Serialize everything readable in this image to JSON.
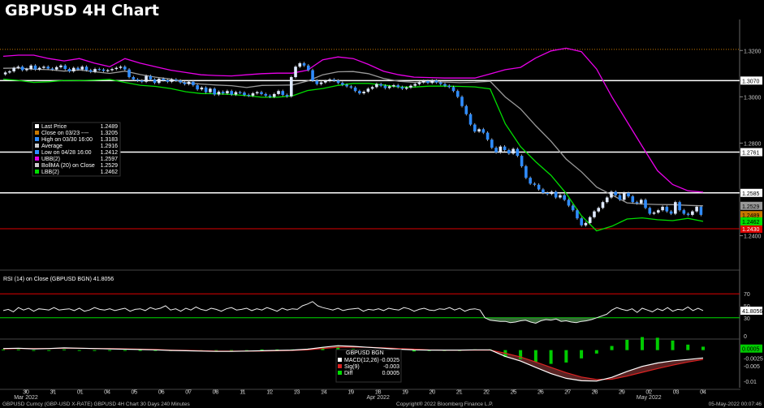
{
  "title": "GBPUSD 4H Chart",
  "colors": {
    "candle": "#2f8cff",
    "ubb": "#e800e8",
    "lbb": "#00dd00",
    "mid": "#999999",
    "close_line": "#c87800",
    "support": "#ffffff",
    "red": "#dd0000"
  },
  "chart_data": {
    "type": "candlestick",
    "x_ticks": [
      "30",
      "31",
      "01",
      "04",
      "05",
      "06",
      "07",
      "08",
      "11",
      "12",
      "13",
      "14",
      "19",
      "18",
      "19",
      "20",
      "21",
      "22",
      "25",
      "26",
      "27",
      "28",
      "29",
      "02",
      "03",
      "04"
    ],
    "month_labels": [
      "Mar 2022",
      "Apr 2022",
      "May 2022"
    ],
    "y_ticks": [
      "1.3200",
      "1.3000",
      "1.2800",
      "1.2400"
    ],
    "y_range": [
      1.236,
      1.332
    ],
    "levels": [
      {
        "name": "close-0323",
        "value": 1.3205,
        "label": "",
        "style": "dotted"
      },
      {
        "name": "resistance-1",
        "value": 1.307,
        "label": "1.3070",
        "style": "white"
      },
      {
        "name": "resistance-2",
        "value": 1.2761,
        "label": "1.2761",
        "style": "white"
      },
      {
        "name": "resistance-3",
        "value": 1.2585,
        "label": "1.2585",
        "style": "white"
      },
      {
        "name": "support-1",
        "value": 1.243,
        "label": "1.2430",
        "style": "red"
      }
    ],
    "price_tags": [
      {
        "value": 1.2529,
        "label": "1.2529",
        "color": "#999999"
      },
      {
        "value": 1.2489,
        "label": "1.2489",
        "color": "#c87800"
      },
      {
        "value": 1.2462,
        "label": "1.2462",
        "color": "#00dd00"
      }
    ],
    "closes": [
      1.3105,
      1.311,
      1.3125,
      1.313,
      1.3115,
      1.312,
      1.3135,
      1.3118,
      1.3125,
      1.313,
      1.3122,
      1.3118,
      1.3128,
      1.3135,
      1.312,
      1.311,
      1.3125,
      1.3118,
      1.313,
      1.3115,
      1.3108,
      1.312,
      1.3118,
      1.3112,
      1.3115,
      1.312,
      1.3125,
      1.313,
      1.3118,
      1.3085,
      1.3075,
      1.307,
      1.3065,
      1.309,
      1.3075,
      1.306,
      1.3078,
      1.3072,
      1.3065,
      1.3075,
      1.307,
      1.3062,
      1.3055,
      1.3065,
      1.305,
      1.3032,
      1.304,
      1.302,
      1.3035,
      1.301,
      1.3022,
      1.3015,
      1.3025,
      1.301,
      1.302,
      1.3018,
      1.3008,
      1.3005,
      1.3015,
      1.302,
      1.3012,
      1.3005,
      1.3,
      1.3012,
      1.3025,
      1.3008,
      1.3002,
      1.3085,
      1.313,
      1.3145,
      1.3135,
      1.3115,
      1.307,
      1.3055,
      1.3062,
      1.3068,
      1.3075,
      1.307,
      1.306,
      1.3052,
      1.3045,
      1.304,
      1.3025,
      1.3015,
      1.3022,
      1.3035,
      1.3042,
      1.3055,
      1.3048,
      1.3038,
      1.3045,
      1.305,
      1.3042,
      1.3035,
      1.304,
      1.3048,
      1.3055,
      1.3062,
      1.3068,
      1.306,
      1.307,
      1.3062,
      1.3055,
      1.3048,
      1.3042,
      1.3025,
      1.3,
      1.296,
      1.2925,
      1.288,
      1.285,
      1.286,
      1.2845,
      1.2815,
      1.278,
      1.276,
      1.2785,
      1.277,
      1.2755,
      1.2775,
      1.2745,
      1.27,
      1.265,
      1.2625,
      1.262,
      1.26,
      1.2585,
      1.258,
      1.259,
      1.2565,
      1.2575,
      1.2555,
      1.253,
      1.251,
      1.2475,
      1.2445,
      1.2455,
      1.248,
      1.2505,
      1.252,
      1.2545,
      1.2565,
      1.259,
      1.2575,
      1.2555,
      1.2585,
      1.257,
      1.2545,
      1.254,
      1.2555,
      1.252,
      1.2495,
      1.25,
      1.251,
      1.2525,
      1.2505,
      1.2495,
      1.2545,
      1.251,
      1.2495,
      1.249,
      1.2505,
      1.2525,
      1.249
    ],
    "ubb": [
      1.3175,
      1.318,
      1.318,
      1.3165,
      1.3155,
      1.3165,
      1.3145,
      1.313,
      1.3165,
      1.3145,
      1.313,
      1.3115,
      1.3105,
      1.3095,
      1.3092,
      1.309,
      1.3095,
      1.31,
      1.3102,
      1.3102,
      1.3115,
      1.316,
      1.3172,
      1.3165,
      1.314,
      1.311,
      1.3095,
      1.3085,
      1.3083,
      1.3081,
      1.3081,
      1.3081,
      1.3099,
      1.3117,
      1.3127,
      1.3168,
      1.3198,
      1.321,
      1.3195,
      1.312,
      1.3,
      1.2893,
      1.2786,
      1.2681,
      1.2621,
      1.2594,
      1.2588
    ],
    "lbb": [
      1.3076,
      1.3071,
      1.3062,
      1.3065,
      1.3071,
      1.307,
      1.3072,
      1.3075,
      1.3062,
      1.305,
      1.3045,
      1.3036,
      1.3022,
      1.3014,
      1.3013,
      1.301,
      1.3005,
      1.2998,
      1.2998,
      1.3004,
      1.3027,
      1.3036,
      1.3049,
      1.3058,
      1.3058,
      1.3051,
      1.3043,
      1.3042,
      1.3046,
      1.3046,
      1.3045,
      1.3043,
      1.3034,
      1.2883,
      1.2785,
      1.2719,
      1.2661,
      1.2583,
      1.2486,
      1.2421,
      1.2441,
      1.2472,
      1.2477,
      1.2469,
      1.2465,
      1.2475,
      1.2462
    ],
    "mid": [
      1.3123,
      1.3124,
      1.3119,
      1.3117,
      1.3111,
      1.3116,
      1.3108,
      1.3101,
      1.3111,
      1.3096,
      1.3085,
      1.3077,
      1.306,
      1.3055,
      1.3051,
      1.3048,
      1.304,
      1.3049,
      1.305,
      1.3051,
      1.3068,
      1.3095,
      1.3108,
      1.3109,
      1.31,
      1.3079,
      1.3067,
      1.3062,
      1.3065,
      1.3064,
      1.3061,
      1.3063,
      1.3067,
      1.2999,
      1.2948,
      1.2875,
      1.2808,
      1.2731,
      1.2676,
      1.261,
      1.2576,
      1.2542,
      1.2537,
      1.2535,
      1.2534,
      1.2531,
      1.2529
    ],
    "rsi": {
      "label": "RSI (14)  on Close (GBPUSD BGN) 41.8056",
      "value": 41.8056,
      "y_ticks": [
        "70",
        "50",
        "30",
        "0"
      ],
      "high_line": 70,
      "low_line": 30,
      "values": [
        42,
        44,
        40,
        47,
        43,
        46,
        41,
        45,
        44,
        43,
        47,
        43,
        44,
        45,
        42,
        46,
        41,
        43,
        47,
        44,
        43,
        45,
        42,
        44,
        46,
        41,
        44,
        45,
        42,
        47,
        44,
        46,
        50,
        43,
        45,
        41,
        46,
        43,
        48,
        44,
        42,
        46,
        44,
        41,
        45,
        47,
        43,
        44,
        46,
        42,
        45,
        43,
        47,
        44,
        41,
        46,
        43,
        45,
        44,
        50,
        53,
        57,
        50,
        47,
        45,
        43,
        46,
        42,
        44,
        45,
        46,
        41,
        44,
        43,
        45,
        42,
        46,
        44,
        43,
        47,
        45,
        41,
        44,
        46,
        43,
        42,
        45,
        44,
        47,
        43,
        46,
        41,
        44,
        45,
        43,
        30,
        26,
        25,
        24,
        24,
        22,
        23,
        25,
        26,
        23,
        21,
        25,
        27,
        26,
        28,
        24,
        25,
        23,
        22,
        24,
        25,
        27,
        30,
        33,
        36,
        43,
        47,
        44,
        42,
        45,
        39,
        46,
        43,
        40,
        45,
        42,
        47,
        41,
        44,
        43,
        48,
        42,
        46,
        42
      ]
    },
    "macd": {
      "header": "GBPUSD BGN",
      "legend": [
        {
          "label": "MACD(12,26)",
          "value": "-0.0025",
          "color": "#ffffff"
        },
        {
          "label": "Sig(9)",
          "value": "-0.003",
          "color": "#dd2222"
        },
        {
          "label": "Diff",
          "value": "0.0005",
          "color": "#00dd00"
        }
      ],
      "y_ticks": [
        "0.0005",
        "-0.0025",
        "-0.005",
        "-0.01"
      ],
      "range": [
        -0.0115,
        0.0025
      ],
      "macd": [
        0.0005,
        0.0006,
        0.0004,
        0.0005,
        0.0007,
        0.0006,
        0.0005,
        0.0004,
        0.0003,
        0.0002,
        0.0001,
        -0.0001,
        -0.0002,
        -0.0003,
        -0.0004,
        -0.0004,
        -0.0003,
        -0.0002,
        -0.0001,
        0,
        0.0003,
        0.0009,
        0.0014,
        0.0012,
        0.0009,
        0.0006,
        0.0003,
        0.0001,
        0,
        0,
        0,
        0.0001,
        0.0001,
        -0.002,
        -0.0035,
        -0.0055,
        -0.0075,
        -0.009,
        -0.0098,
        -0.0099,
        -0.0087,
        -0.0068,
        -0.0052,
        -0.0041,
        -0.0034,
        -0.003,
        -0.0025
      ],
      "sig": [
        0.0004,
        0.0005,
        0.0005,
        0.0005,
        0.0006,
        0.0006,
        0.0005,
        0.0005,
        0.0004,
        0.0003,
        0.0002,
        0,
        -0.0001,
        -0.0002,
        -0.0003,
        -0.0003,
        -0.0003,
        -0.0003,
        -0.0002,
        -0.0001,
        0.0001,
        0.0005,
        0.0009,
        0.001,
        0.0009,
        0.0007,
        0.0005,
        0.0003,
        0.0001,
        0,
        0,
        0,
        0,
        -0.001,
        -0.0022,
        -0.0038,
        -0.0055,
        -0.0072,
        -0.0086,
        -0.0094,
        -0.0093,
        -0.0083,
        -0.0071,
        -0.0059,
        -0.0048,
        -0.0038,
        -0.003
      ]
    },
    "footer": {
      "left": "GBPUSD Curncy (GBP-USD X-RATE) GBPUSD 4H Chart 30 Days 240 Minutes",
      "center": "Copyright® 2022 Bloomberg Finance L.P.",
      "right": "05-May-2022 00:07:46"
    }
  },
  "legend": [
    {
      "label": "Last Price",
      "value": "1.2489",
      "color": "#ffffff"
    },
    {
      "label": "Close on 03/23 ----",
      "value": "1.3205",
      "color": "#c87800"
    },
    {
      "label": "High on 03/30 16:00",
      "value": "1.3183",
      "color": "#2f8cff"
    },
    {
      "label": "Average",
      "value": "1.2916",
      "color": "#cccccc"
    },
    {
      "label": "Low on 04/28 16:00",
      "value": "1.2412",
      "color": "#2f8cff"
    },
    {
      "label": "UBB(2)",
      "value": "1.2597",
      "color": "#e800e8"
    },
    {
      "label": "BollMA (20)  on Close",
      "value": "1.2529",
      "color": "#cccccc"
    },
    {
      "label": "LBB(2)",
      "value": "1.2462",
      "color": "#00dd00"
    }
  ]
}
